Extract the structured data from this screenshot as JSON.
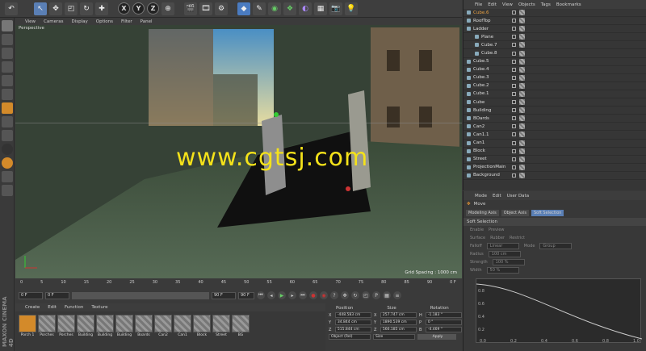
{
  "viewport": {
    "menu": [
      "View",
      "Cameras",
      "Display",
      "Options",
      "Filter",
      "Panel"
    ],
    "label": "Perspective",
    "grid": "Grid Spacing : 1000 cm",
    "watermark": "www.cgtsj.com"
  },
  "toolbar": {
    "axes": [
      "X",
      "Y",
      "Z"
    ]
  },
  "timeline": {
    "ticks": [
      "0",
      "5",
      "10",
      "15",
      "20",
      "25",
      "30",
      "35",
      "40",
      "45",
      "50",
      "55",
      "60",
      "65",
      "70",
      "75",
      "80",
      "85",
      "90"
    ],
    "start": "0 F",
    "end": "90 F",
    "current": "0 F",
    "max": "90 F",
    "end_label": "0 F"
  },
  "materials": {
    "menu": [
      "Create",
      "Edit",
      "Function",
      "Texture"
    ],
    "items": [
      "Porch 1",
      "Porches",
      "Porches",
      "Building",
      "Building",
      "Building",
      "Boards",
      "Can2",
      "Can1",
      "Block",
      "Street",
      "BG"
    ]
  },
  "coords": {
    "headers": [
      "Position",
      "Size",
      "Rotation"
    ],
    "rows": [
      {
        "axis": "X",
        "pos": "-448.583 cm",
        "size": "257.747 cm",
        "rlabel": "H",
        "rot": "-1.183 °"
      },
      {
        "axis": "Y",
        "pos": "34.844 cm",
        "size": "1890.539 cm",
        "rlabel": "P",
        "rot": "0 °"
      },
      {
        "axis": "Z",
        "pos": "515.844 cm",
        "size": "566.185 cm",
        "rlabel": "B",
        "rot": "-4.469 °"
      }
    ],
    "mode": "Object (Rel)",
    "size_mode": "Size",
    "apply": "Apply"
  },
  "objects": {
    "menu": [
      "File",
      "Edit",
      "View",
      "Objects",
      "Tags",
      "Bookmarks"
    ],
    "items": [
      "Cube.6",
      "RoofTop",
      "Ladder",
      "Plane",
      "Cube.7",
      "Cube.8",
      "Cube.5",
      "Cube.4",
      "Cube.3",
      "Cube.2",
      "Cube.1",
      "Cube",
      "Building",
      "BOards",
      "Can2",
      "Can1.1",
      "Can1",
      "Block",
      "Street",
      "ProjectionMain",
      "Background"
    ]
  },
  "attributes": {
    "menu": [
      "Mode",
      "Edit",
      "User Data"
    ],
    "tool": "Move",
    "tabs": [
      "Modeling Axis",
      "Object Axis",
      "Soft Selection"
    ],
    "section": "Soft Selection",
    "rows": [
      {
        "a": "Enable",
        "b": "Preview"
      },
      {
        "a": "Surface",
        "b": "Rubber",
        "c": "Restrict"
      },
      {
        "a": "Falloff",
        "v": "Linear",
        "b": "Mode",
        "w": "Group"
      },
      {
        "a": "Radius",
        "v": "100 cm"
      },
      {
        "a": "Strength",
        "v": "100 %"
      },
      {
        "a": "Width",
        "v": "50 %"
      }
    ],
    "graph_x": [
      "0.0",
      "0.2",
      "0.4",
      "0.6",
      "0.8",
      "1.0"
    ],
    "graph_y": [
      "0.8",
      "0.6",
      "0.4",
      "0.2"
    ]
  },
  "brand": "MAXON CINEMA 4D"
}
